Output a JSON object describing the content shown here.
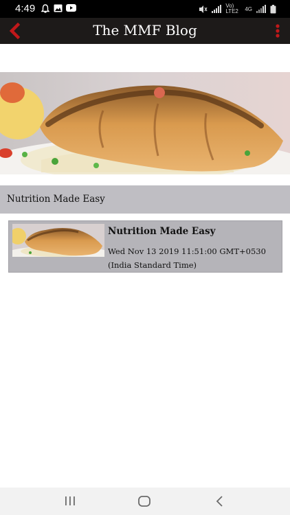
{
  "status_bar": {
    "time": "4:49",
    "left_icons": [
      "bell-icon",
      "image-icon",
      "youtube-icon"
    ],
    "right_labels": {
      "volte": "Vo) LTE2",
      "network": "4G"
    },
    "right_icons": [
      "mute-icon",
      "signal-icon",
      "signal-icon",
      "battery-icon"
    ]
  },
  "app_bar": {
    "title": "The MMF Blog",
    "back_icon": "chevron-left-icon",
    "menu_icon": "kebab-menu-icon",
    "accent_color": "#c0181a"
  },
  "section": {
    "title": "Nutrition Made Easy"
  },
  "posts": [
    {
      "title": "Nutrition Made Easy",
      "date": "Wed Nov 13 2019 11:51:00 GMT+0530 (India Standard Time)"
    }
  ],
  "nav_bar": {
    "icons": [
      "recents-icon",
      "home-icon",
      "back-icon"
    ]
  }
}
